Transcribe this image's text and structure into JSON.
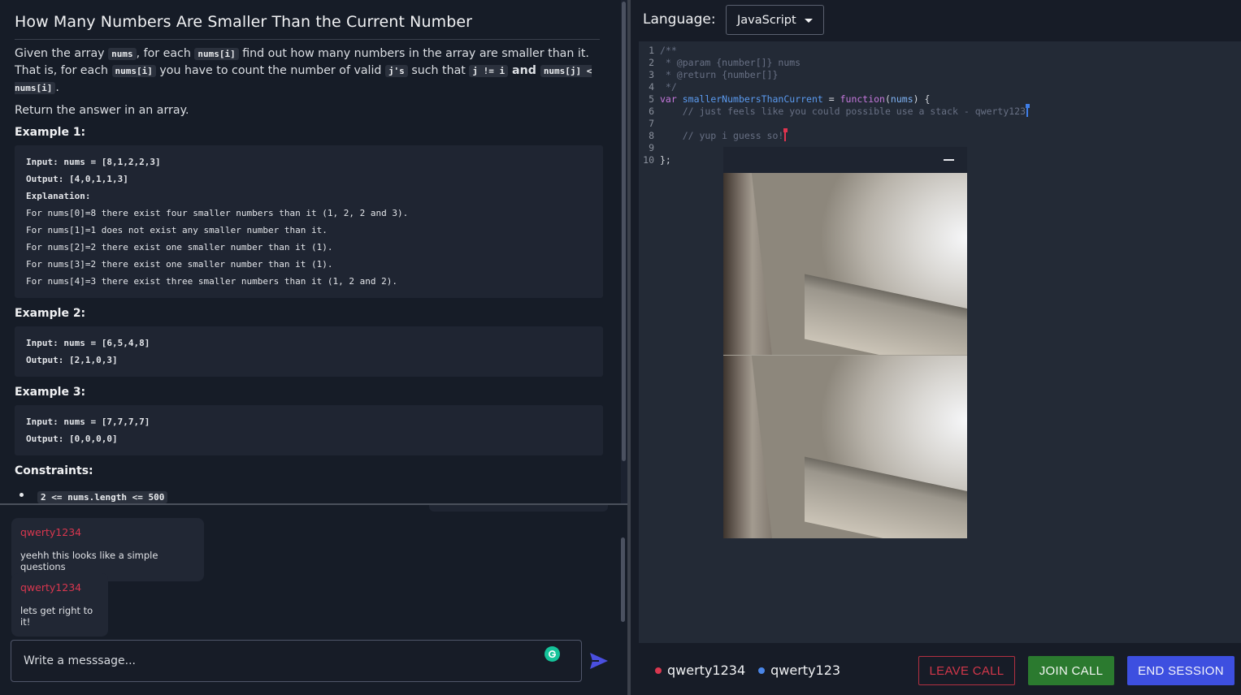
{
  "problem": {
    "title": "How Many Numbers Are Smaller Than the Current Number",
    "desc": {
      "t1": "Given the array ",
      "c1": "nums",
      "t2": ", for each ",
      "c2": "nums[i]",
      "t3": " find out how many numbers in the array are smaller than it. That is, for each ",
      "c3": "nums[i]",
      "t4": " you have to count the number of valid ",
      "c4": "j's",
      "t5": " such that ",
      "c5": "j != i",
      "t6": " and ",
      "c6": "nums[j] < nums[i]",
      "t7": "."
    },
    "return_text": "Return the answer in an array.",
    "examples": [
      {
        "heading": "Example 1:",
        "lines": [
          "Input: nums = [8,1,2,2,3]",
          "Output: [4,0,1,1,3]",
          "Explanation:",
          "For nums[0]=8 there exist four smaller numbers than it (1, 2, 2 and 3).",
          "For nums[1]=1 does not exist any smaller number than it.",
          "For nums[2]=2 there exist one smaller number than it (1).",
          "For nums[3]=2 there exist one smaller number than it (1).",
          "For nums[4]=3 there exist three smaller numbers than it (1, 2 and 2)."
        ]
      },
      {
        "heading": "Example 2:",
        "lines": [
          "Input: nums = [6,5,4,8]",
          "Output: [2,1,0,3]"
        ]
      },
      {
        "heading": "Example 3:",
        "lines": [
          "Input: nums = [7,7,7,7]",
          "Output: [0,0,0,0]"
        ]
      }
    ],
    "constraints_heading": "Constraints:",
    "constraints": [
      "2 <= nums.length <= 500"
    ]
  },
  "chat": {
    "messages": [
      {
        "user": "qwerty1234",
        "text": "yeehh this looks like a simple questions"
      },
      {
        "user": "qwerty1234",
        "text": "lets get right to it!"
      }
    ],
    "input_placeholder": "Write a messsage..."
  },
  "editor": {
    "language_label": "Language:",
    "language": "JavaScript",
    "lines": [
      "/**",
      " * @param {number[]} nums",
      " * @return {number[]}",
      " */",
      "var smallerNumbersThanCurrent = function(nums) {",
      "    // just feels like you could possible use a stack - qwerty123",
      "",
      "    // yup i guess so!",
      "",
      "};"
    ]
  },
  "session": {
    "participants": [
      {
        "name": "qwerty1234",
        "color": "#d9374f"
      },
      {
        "name": "qwerty123",
        "color": "#4a86e8"
      }
    ],
    "buttons": {
      "leave": "LEAVE CALL",
      "join": "JOIN CALL",
      "end": "END SESSION"
    }
  },
  "icons": {
    "send": "send-icon",
    "grammarly": "grammarly-icon",
    "minimize": "minimize-icon",
    "dropdown": "caret-down-icon"
  }
}
